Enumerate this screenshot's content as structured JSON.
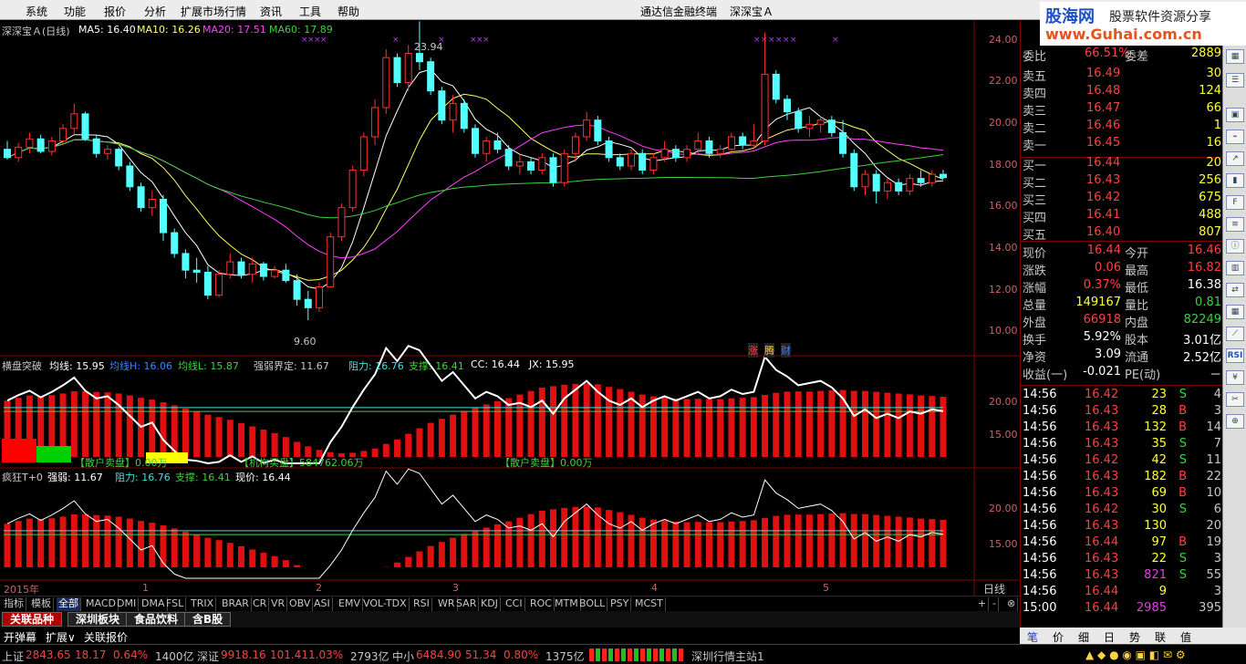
{
  "menu": [
    "系统",
    "功能",
    "报价",
    "分析",
    "扩展市场行情",
    "资讯",
    "工具",
    "帮助"
  ],
  "window_title": "通达信金融终端",
  "stock_title": "深深宝Ａ",
  "watermark": {
    "site": "股海网",
    "slogan": "股票软件资源分享",
    "url": "www.Guhai.com.cn"
  },
  "main_panel": {
    "label": "深深宝Ａ(日线)",
    "ma5": "MA5: 16.40",
    "ma10": "MA10: 16.26",
    "ma20": "MA20: 17.51",
    "ma60": "MA60: 17.89",
    "high_mark": "23.94",
    "low_mark": "9.60",
    "y_ticks": [
      "24.00",
      "22.00",
      "20.00",
      "18.00",
      "16.00",
      "14.00",
      "12.00",
      "10.00"
    ],
    "badges": [
      "涨",
      "腾",
      "财"
    ]
  },
  "ind1": {
    "name": "横盘突破",
    "junxian": "均线: 15.95",
    "junxianH": "均线H: 16.06",
    "junxianL": "均线L: 15.87",
    "qrjd": "强弱界定: 11.67",
    "zuli": "阻力: 16.76",
    "zhicheng": "支撑: 16.41",
    "cc": "CC: 16.44",
    "jx": "JX: 15.95",
    "y_ticks": [
      "20.00",
      "15.00"
    ],
    "sanhu1": "【散户卖盘】0.00万",
    "jigou": "【机构买盘】584762.06万",
    "sanhu2": "【散户卖盘】0.00万"
  },
  "ind2": {
    "name": "疯狂T+0",
    "qiangruo": "强弱: 11.67",
    "zuli": "阻力: 16.76",
    "zhicheng": "支撑: 16.41",
    "xianjia": "现价: 16.44",
    "y_ticks": [
      "20.00",
      "15.00"
    ]
  },
  "x_axis": {
    "labels": [
      "2015年",
      "1",
      "2",
      "3",
      "4",
      "5"
    ],
    "period": "日线"
  },
  "quote": {
    "weibi": {
      "label": "委比",
      "val": "66.51%",
      "label2": "委差",
      "val2": "2889"
    },
    "sells": [
      {
        "label": "卖五",
        "price": "16.49",
        "vol": "30"
      },
      {
        "label": "卖四",
        "price": "16.48",
        "vol": "124"
      },
      {
        "label": "卖三",
        "price": "16.47",
        "vol": "66"
      },
      {
        "label": "卖二",
        "price": "16.46",
        "vol": "1"
      },
      {
        "label": "卖一",
        "price": "16.45",
        "vol": "16"
      }
    ],
    "buys": [
      {
        "label": "买一",
        "price": "16.44",
        "vol": "20"
      },
      {
        "label": "买二",
        "price": "16.43",
        "vol": "256"
      },
      {
        "label": "买三",
        "price": "16.42",
        "vol": "675"
      },
      {
        "label": "买四",
        "price": "16.41",
        "vol": "488"
      },
      {
        "label": "买五",
        "price": "16.40",
        "vol": "807"
      }
    ],
    "stats": [
      {
        "l1": "现价",
        "v1": "16.44",
        "l2": "今开",
        "v2": "16.46"
      },
      {
        "l1": "涨跌",
        "v1": "0.06",
        "l2": "最高",
        "v2": "16.82"
      },
      {
        "l1": "涨幅",
        "v1": "0.37%",
        "l2": "最低",
        "v2": "16.38"
      },
      {
        "l1": "总量",
        "v1": "149167",
        "l2": "量比",
        "v2": "0.81"
      },
      {
        "l1": "外盘",
        "v1": "66918",
        "l2": "内盘",
        "v2": "82249"
      },
      {
        "l1": "换手",
        "v1": "5.92%",
        "l2": "股本",
        "v2": "3.01亿"
      },
      {
        "l1": "净资",
        "v1": "3.09",
        "l2": "流通",
        "v2": "2.52亿"
      },
      {
        "l1": "收益(一)",
        "v1": "-0.021",
        "l2": "PE(动)",
        "v2": "－"
      }
    ],
    "ticks": [
      {
        "t": "14:56",
        "p": "16.42",
        "v": "23",
        "s": "S",
        "n": "4"
      },
      {
        "t": "14:56",
        "p": "16.43",
        "v": "28",
        "s": "B",
        "n": "3"
      },
      {
        "t": "14:56",
        "p": "16.43",
        "v": "132",
        "s": "B",
        "n": "14"
      },
      {
        "t": "14:56",
        "p": "16.43",
        "v": "35",
        "s": "S",
        "n": "7"
      },
      {
        "t": "14:56",
        "p": "16.42",
        "v": "42",
        "s": "S",
        "n": "11"
      },
      {
        "t": "14:56",
        "p": "16.43",
        "v": "182",
        "s": "B",
        "n": "22"
      },
      {
        "t": "14:56",
        "p": "16.43",
        "v": "69",
        "s": "B",
        "n": "10"
      },
      {
        "t": "14:56",
        "p": "16.42",
        "v": "30",
        "s": "S",
        "n": "6"
      },
      {
        "t": "14:56",
        "p": "16.43",
        "v": "130",
        "s": "",
        "n": "20"
      },
      {
        "t": "14:56",
        "p": "16.44",
        "v": "97",
        "s": "B",
        "n": "19"
      },
      {
        "t": "14:56",
        "p": "16.43",
        "v": "22",
        "s": "S",
        "n": "3"
      },
      {
        "t": "14:56",
        "p": "16.43",
        "v": "821",
        "s": "S",
        "n": "55"
      },
      {
        "t": "14:56",
        "p": "16.44",
        "v": "9",
        "s": "",
        "n": "3"
      },
      {
        "t": "15:00",
        "p": "16.44",
        "v": "2985",
        "s": "",
        "n": "395"
      }
    ]
  },
  "indicators": [
    "指标",
    "模板",
    "全部",
    "MACD",
    "DMI",
    "DMA",
    "FSL",
    "TRIX",
    "BRAR",
    "CR",
    "VR",
    "OBV",
    "ASI",
    "EMV",
    "VOL-TDX",
    "RSI",
    "WR",
    "SAR",
    "KDJ",
    "CCI",
    "ROC",
    "MTM",
    "BOLL",
    "PSY",
    "MCST"
  ],
  "tabs": [
    "关联品种",
    "深圳板块",
    "食品饮料",
    "含B股"
  ],
  "bar3": [
    "开弹幕",
    "扩展∨",
    "关联报价"
  ],
  "right_bottom": [
    "笔",
    "价",
    "细",
    "日",
    "势",
    "联",
    "值"
  ],
  "status": {
    "sh": {
      "name": "上证",
      "v": "2843.65",
      "c": "18.17",
      "p": "0.64%",
      "a": "1400亿"
    },
    "sz": {
      "name": "深证",
      "v": "9918.16",
      "c": "101.41",
      "p": "1.03%",
      "a": "2793亿"
    },
    "zx": {
      "name": "中小",
      "v": "6484.90",
      "c": "51.34",
      "p": "0.80%",
      "a": "1375亿"
    },
    "server": "深圳行情主站1"
  },
  "chart_data": {
    "type": "candlestick",
    "title": "深深宝Ａ(日线)",
    "ylim": [
      9,
      25
    ],
    "candles": [
      [
        17.8,
        18.2,
        17.3,
        17.4
      ],
      [
        17.4,
        18.1,
        17.2,
        17.9
      ],
      [
        17.9,
        18.6,
        17.6,
        18.3
      ],
      [
        18.3,
        18.5,
        17.6,
        17.7
      ],
      [
        17.7,
        18.4,
        17.5,
        18.2
      ],
      [
        18.2,
        19.0,
        18.0,
        18.8
      ],
      [
        18.8,
        20.0,
        18.5,
        19.5
      ],
      [
        19.5,
        19.6,
        18.2,
        18.3
      ],
      [
        18.3,
        18.5,
        17.4,
        17.6
      ],
      [
        17.6,
        18.0,
        17.3,
        17.8
      ],
      [
        17.8,
        17.9,
        16.8,
        17.0
      ],
      [
        17.0,
        17.2,
        15.8,
        16.0
      ],
      [
        16.0,
        16.2,
        14.8,
        15.0
      ],
      [
        15.0,
        15.8,
        14.6,
        15.4
      ],
      [
        15.4,
        15.6,
        13.4,
        13.8
      ],
      [
        13.8,
        14.0,
        12.6,
        12.8
      ],
      [
        12.8,
        13.0,
        11.6,
        12.0
      ],
      [
        12.0,
        12.6,
        11.4,
        11.9
      ],
      [
        11.9,
        12.2,
        10.6,
        10.8
      ],
      [
        10.8,
        12.0,
        10.7,
        11.8
      ],
      [
        11.8,
        12.8,
        11.6,
        12.4
      ],
      [
        12.4,
        12.6,
        11.6,
        11.8
      ],
      [
        11.8,
        12.6,
        11.4,
        12.3
      ],
      [
        12.3,
        12.4,
        11.5,
        11.7
      ],
      [
        11.7,
        12.2,
        11.6,
        12.0
      ],
      [
        12.0,
        12.3,
        11.4,
        11.5
      ],
      [
        11.5,
        11.8,
        10.3,
        10.6
      ],
      [
        10.6,
        11.0,
        9.6,
        10.2
      ],
      [
        10.2,
        11.4,
        10.0,
        11.2
      ],
      [
        11.2,
        13.8,
        11.2,
        13.6
      ],
      [
        13.6,
        15.2,
        13.4,
        15.0
      ],
      [
        15.0,
        17.0,
        14.8,
        16.8
      ],
      [
        16.8,
        18.6,
        16.5,
        18.4
      ],
      [
        18.4,
        20.2,
        18.0,
        19.8
      ],
      [
        19.8,
        22.6,
        19.5,
        22.2
      ],
      [
        22.2,
        22.4,
        20.8,
        21.0
      ],
      [
        21.0,
        22.8,
        20.6,
        22.4
      ],
      [
        22.4,
        23.94,
        21.6,
        22.0
      ],
      [
        22.0,
        22.2,
        20.4,
        20.6
      ],
      [
        20.6,
        20.8,
        19.0,
        19.2
      ],
      [
        19.2,
        20.4,
        18.6,
        20.0
      ],
      [
        20.0,
        20.2,
        18.6,
        18.8
      ],
      [
        18.8,
        19.0,
        17.4,
        17.6
      ],
      [
        17.6,
        18.4,
        17.2,
        18.2
      ],
      [
        18.2,
        18.6,
        17.6,
        17.8
      ],
      [
        17.8,
        18.0,
        16.8,
        17.0
      ],
      [
        17.0,
        17.6,
        16.6,
        17.2
      ],
      [
        17.2,
        17.4,
        16.6,
        16.8
      ],
      [
        16.8,
        17.6,
        16.6,
        17.4
      ],
      [
        17.4,
        17.6,
        16.0,
        16.2
      ],
      [
        16.2,
        17.8,
        16.0,
        17.6
      ],
      [
        17.6,
        18.6,
        17.2,
        18.4
      ],
      [
        18.4,
        19.6,
        18.2,
        19.2
      ],
      [
        19.2,
        19.4,
        18.0,
        18.2
      ],
      [
        18.2,
        18.4,
        17.2,
        17.4
      ],
      [
        17.4,
        17.6,
        16.8,
        17.0
      ],
      [
        17.0,
        17.8,
        16.8,
        17.6
      ],
      [
        17.6,
        17.8,
        16.6,
        16.8
      ],
      [
        16.8,
        17.6,
        16.6,
        17.4
      ],
      [
        17.4,
        18.2,
        17.2,
        17.8
      ],
      [
        17.8,
        18.0,
        17.2,
        17.4
      ],
      [
        17.4,
        18.0,
        17.2,
        17.8
      ],
      [
        17.8,
        18.6,
        17.6,
        18.2
      ],
      [
        18.2,
        18.4,
        17.4,
        17.6
      ],
      [
        17.6,
        18.0,
        17.4,
        17.8
      ],
      [
        17.8,
        18.6,
        17.6,
        18.4
      ],
      [
        18.4,
        18.6,
        17.8,
        18.0
      ],
      [
        18.0,
        19.0,
        17.8,
        18.2
      ],
      [
        18.2,
        23.4,
        18.0,
        21.4
      ],
      [
        21.4,
        21.6,
        20.0,
        20.2
      ],
      [
        20.2,
        20.4,
        19.2,
        19.6
      ],
      [
        19.6,
        19.8,
        18.6,
        18.8
      ],
      [
        18.8,
        19.4,
        18.4,
        19.0
      ],
      [
        19.0,
        19.4,
        18.6,
        19.2
      ],
      [
        19.2,
        19.4,
        18.4,
        18.6
      ],
      [
        18.6,
        19.2,
        17.4,
        17.6
      ],
      [
        17.6,
        17.8,
        15.8,
        16.0
      ],
      [
        16.0,
        16.8,
        15.6,
        16.6
      ],
      [
        16.6,
        16.8,
        15.2,
        15.8
      ],
      [
        15.8,
        16.4,
        15.4,
        16.2
      ],
      [
        16.2,
        16.4,
        15.6,
        15.8
      ],
      [
        15.8,
        16.6,
        15.6,
        16.4
      ],
      [
        16.4,
        16.8,
        16.0,
        16.2
      ],
      [
        16.2,
        16.8,
        16.0,
        16.6
      ],
      [
        16.6,
        16.82,
        16.38,
        16.44
      ]
    ],
    "ma_lines": {
      "MA5": "#ffffff",
      "MA10": "#ffff66",
      "MA20": "#ff40ff",
      "MA60": "#40d040"
    }
  }
}
